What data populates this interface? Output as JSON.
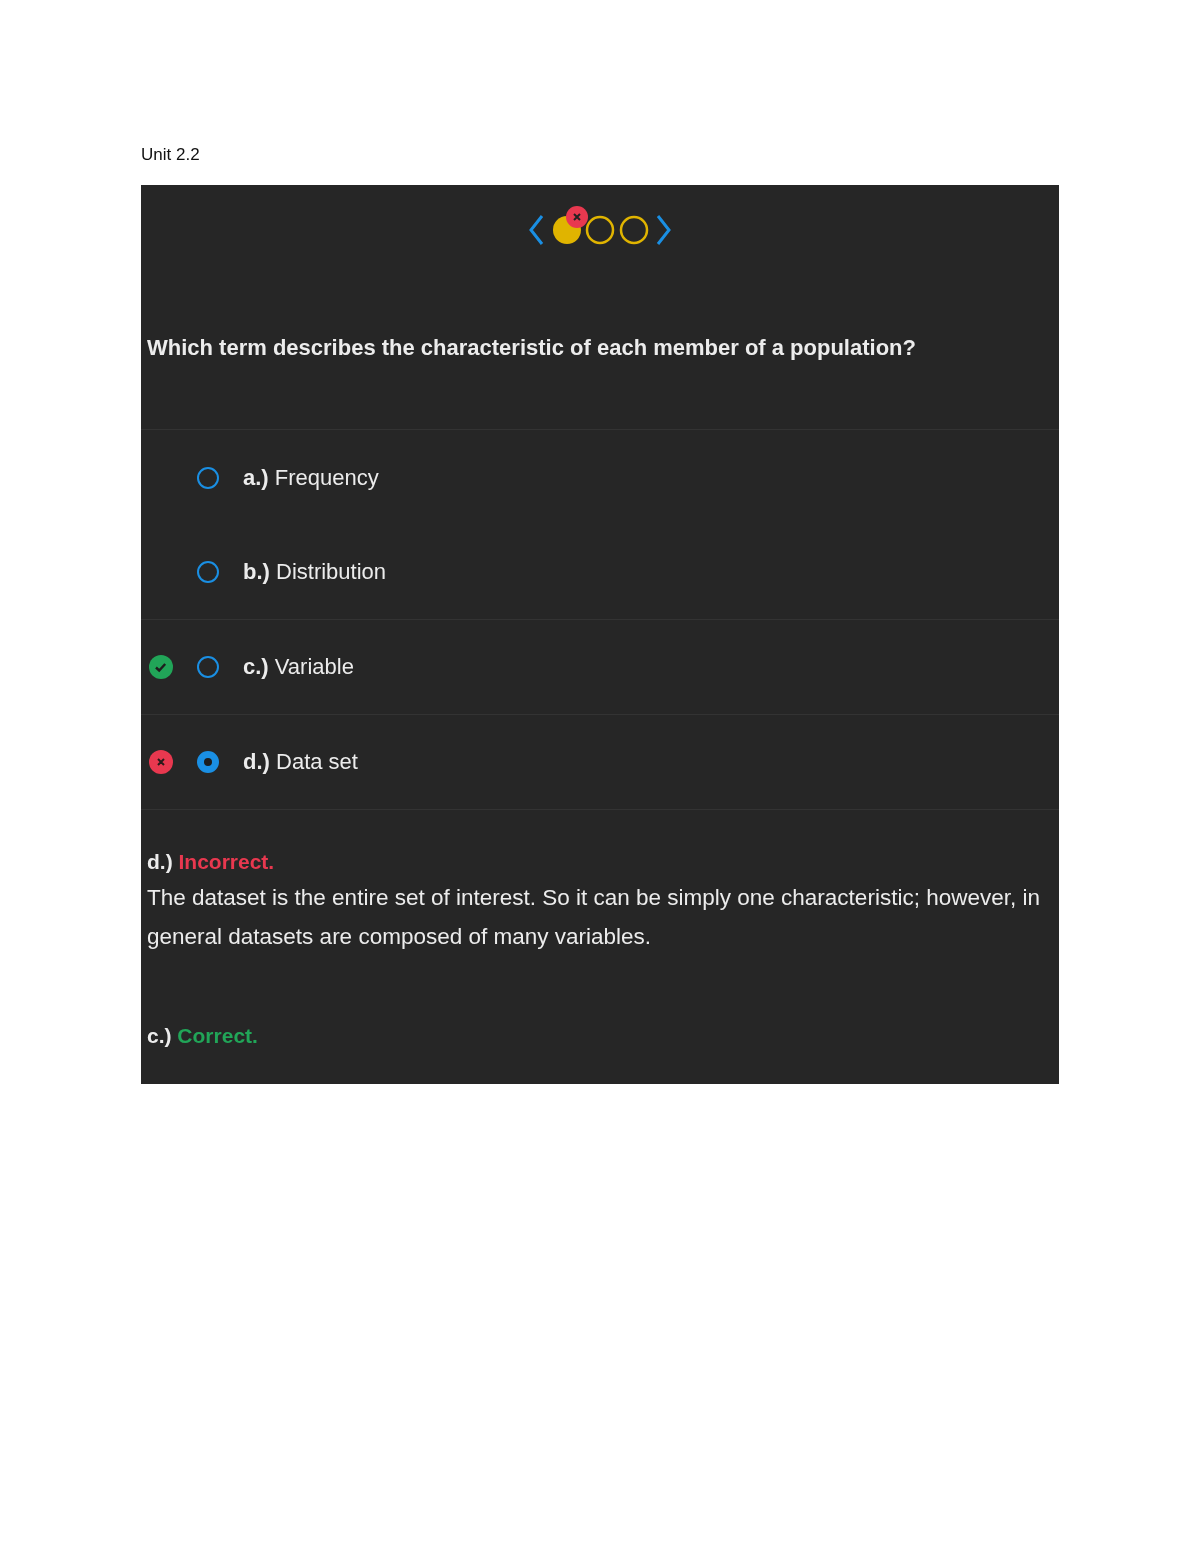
{
  "heading": "Unit 2.2",
  "nav": {
    "steps": [
      {
        "kind": "incorrect"
      },
      {
        "kind": "unanswered"
      },
      {
        "kind": "unanswered"
      }
    ]
  },
  "question": "Which term describes the characteristic of each member of a population?",
  "choices": [
    {
      "letter": "a.)",
      "text": "Frequency",
      "selected": false,
      "kind": "none"
    },
    {
      "letter": "b.)",
      "text": "Distribution",
      "selected": false,
      "kind": "none"
    },
    {
      "letter": "c.)",
      "text": "Variable",
      "selected": false,
      "kind": "correct"
    },
    {
      "letter": "d.)",
      "text": "Data set",
      "selected": true,
      "kind": "incorrect"
    }
  ],
  "feedback": [
    {
      "letter": "d.)",
      "verdict": "Incorrect.",
      "kind": "incorrect",
      "text": "The dataset is the entire set of interest. So it can be simply one characteristic; however, in general datasets are composed of many variables."
    },
    {
      "letter": "c.)",
      "verdict": "Correct.",
      "kind": "correct"
    }
  ]
}
